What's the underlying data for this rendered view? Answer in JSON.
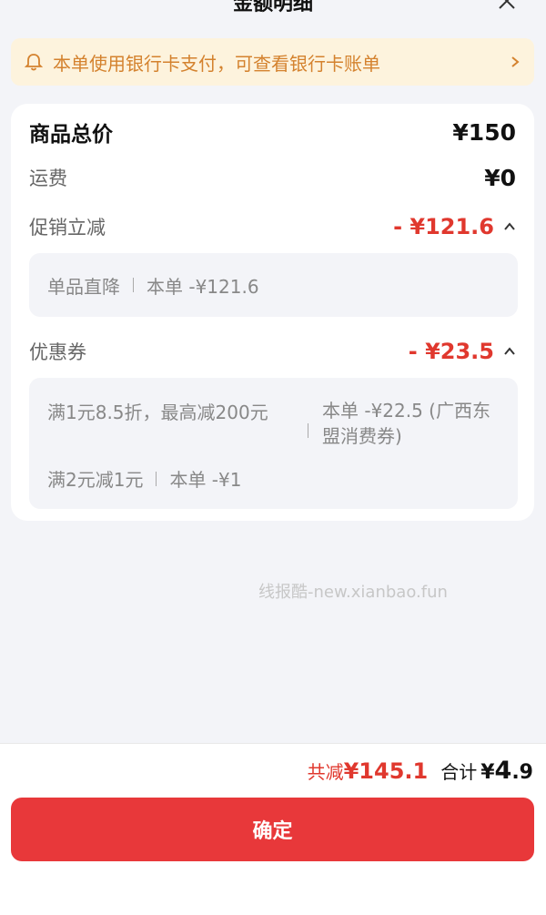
{
  "header": {
    "title": "金额明细"
  },
  "notice": {
    "text": "本单使用银行卡支付，可查看银行卡账单"
  },
  "summary": {
    "goods_label": "商品总价",
    "goods_amount": "¥150",
    "shipping_label": "运费",
    "shipping_amount": "¥0",
    "promo_label": "促销立减",
    "promo_amount": "- ¥121.6",
    "promo_detail": {
      "name": "单品直降",
      "value": "本单 -¥121.6"
    },
    "coupon_label": "优惠券",
    "coupon_amount": "- ¥23.5",
    "coupon_details": [
      {
        "name": "满1元8.5折，最高减200元",
        "value": "本单 -¥22.5 (广西东盟消费券)"
      },
      {
        "name": "满2元减1元",
        "value": "本单 -¥1"
      }
    ]
  },
  "watermark": "线报酷-new.xianbao.fun",
  "footer": {
    "discount_prefix": "共减",
    "discount_amount": "¥145.1",
    "total_label": "合计",
    "total_symbol": "¥",
    "total_int": "4",
    "total_dec": ".9",
    "confirm_label": "确定"
  },
  "colors": {
    "accent_red": "#e8383a",
    "notice_text": "#d4822e",
    "notice_bg": "#fdf3dd"
  },
  "icons": {
    "notice": "bell-icon",
    "notice_arrow": "chevron-right-icon",
    "close": "close-icon",
    "collapse": "chevron-up-icon"
  }
}
